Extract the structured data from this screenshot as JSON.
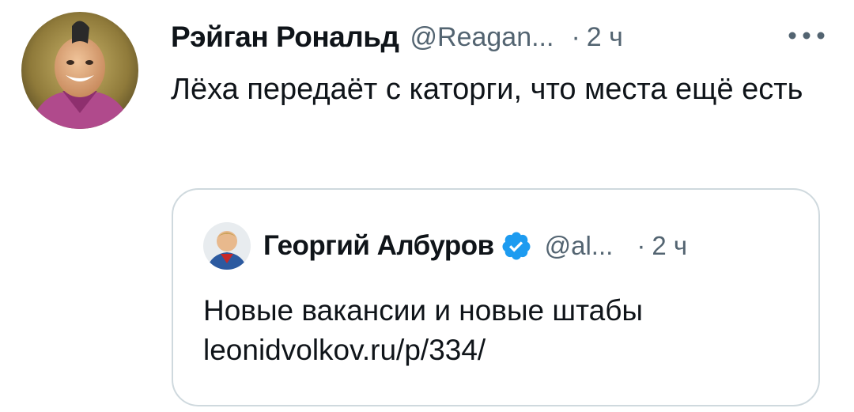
{
  "tweet": {
    "author_name": "Рэйган Рональд",
    "author_handle": "@Reagan...",
    "separator": "·",
    "time": "2 ч",
    "more_icon": "more-horizontal-icon",
    "text": "Лёха передаёт с каторги, что места ещё есть"
  },
  "quote": {
    "author_name": "Георгий Албуров",
    "verified_icon": "verified-badge-icon",
    "author_handle": "@al...",
    "separator": "·",
    "time": "2 ч",
    "text": "Новые вакансии и новые штабы",
    "link": "leonidvolkov.ru/p/334/"
  },
  "colors": {
    "text_primary": "#0f1419",
    "text_secondary": "#536471",
    "card_border": "#cfd9de",
    "verified_blue": "#1d9bf0"
  }
}
